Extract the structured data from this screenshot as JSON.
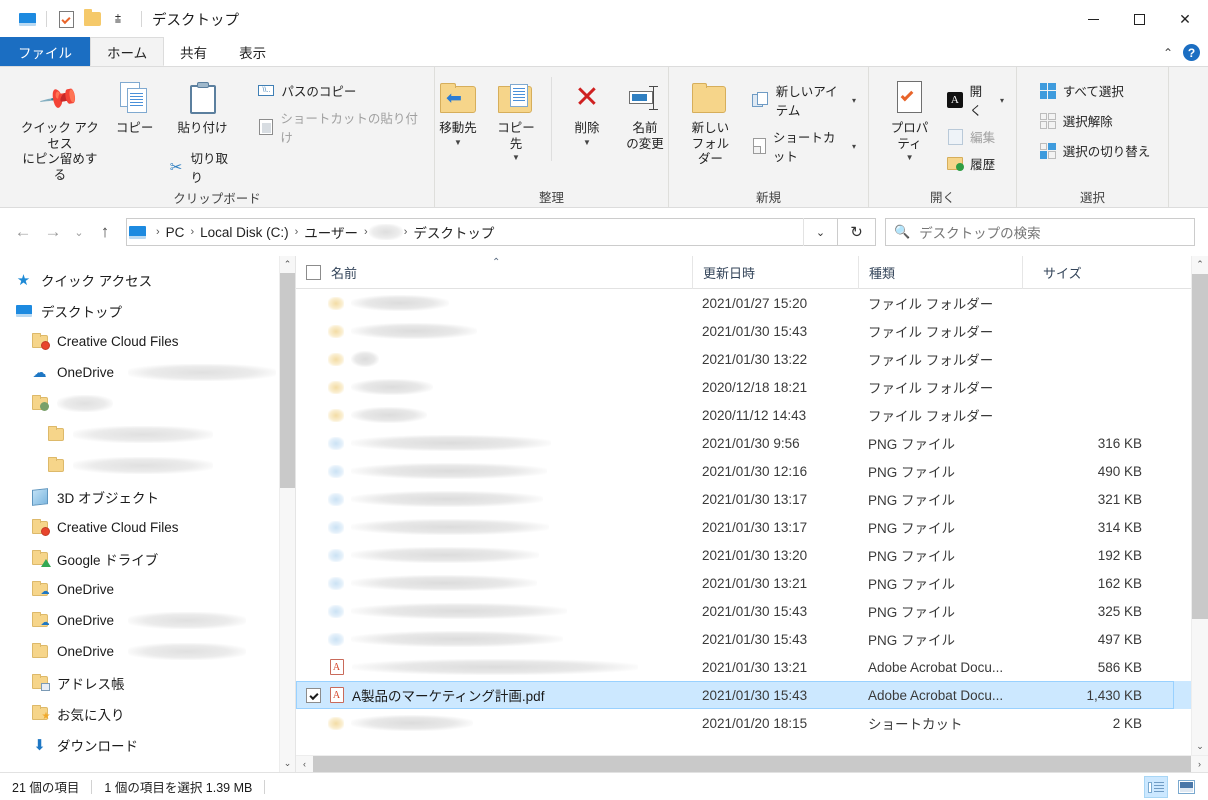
{
  "window": {
    "title": "デスクトップ",
    "quick_access_icons": [
      "pc-icon",
      "properties-checkmark-icon",
      "new-folder-icon",
      "quick-access-dropdown-icon"
    ],
    "minimize_label": "",
    "maximize_label": "",
    "close_label": "✕"
  },
  "ribbon": {
    "tabs": [
      {
        "label": "ファイル",
        "kind": "file"
      },
      {
        "label": "ホーム",
        "kind": "active"
      },
      {
        "label": "共有",
        "kind": "normal"
      },
      {
        "label": "表示",
        "kind": "normal"
      }
    ],
    "collapse_icon": "⌃",
    "help_icon": "?",
    "groups": [
      {
        "name": "clipboard",
        "label": "クリップボード",
        "pin_label_line1": "クイック アクセス",
        "pin_label_line2": "にピン留めする",
        "copy_label": "コピー",
        "paste_label": "貼り付け",
        "cut_label": "切り取り",
        "copy_path_label": "パスのコピー",
        "paste_shortcut_label": "ショートカットの貼り付け"
      },
      {
        "name": "organize",
        "label": "整理",
        "move_to_label": "移動先",
        "copy_to_label": "コピー先",
        "delete_label": "削除",
        "rename_label_line1": "名前",
        "rename_label_line2": "の変更"
      },
      {
        "name": "new",
        "label": "新規",
        "new_folder_line1": "新しい",
        "new_folder_line2": "フォルダー",
        "new_item_label": "新しいアイテム",
        "shortcut_label": "ショートカット"
      },
      {
        "name": "open",
        "label": "開く",
        "properties_label": "プロパティ",
        "open_label": "開く",
        "edit_label": "編集",
        "history_label": "履歴"
      },
      {
        "name": "select",
        "label": "選択",
        "select_all_label": "すべて選択",
        "select_none_label": "選択解除",
        "invert_selection_label": "選択の切り替え"
      }
    ]
  },
  "address_bar": {
    "back_icon": "←",
    "forward_icon": "→",
    "recent_icon": "⌄",
    "up_icon": "↑",
    "breadcrumbs": [
      "PC",
      "Local Disk (C:)",
      "ユーザー",
      "",
      "デスクトップ"
    ],
    "breadcrumb_redacted_index": 3,
    "separator": "›",
    "dropdown_icon": "⌄",
    "refresh_icon": "↻"
  },
  "search": {
    "icon": "search-icon",
    "placeholder": "デスクトップの検索",
    "value": ""
  },
  "sidebar": {
    "items": [
      {
        "label": "クイック アクセス",
        "icon": "star-icon",
        "indent": 0,
        "redacted_width": 0
      },
      {
        "label": "デスクトップ",
        "icon": "desktop-icon",
        "indent": 0,
        "redacted_width": 0
      },
      {
        "label": "Creative Cloud Files",
        "icon": "creative-cloud-folder-icon",
        "indent": 1,
        "redacted_width": 0
      },
      {
        "label": "OneDrive",
        "icon": "onedrive-cloud-icon",
        "indent": 1,
        "redacted_width": 148
      },
      {
        "label": "",
        "icon": "user-folder-icon",
        "indent": 1,
        "redacted_width": 56
      },
      {
        "label": "",
        "icon": "folder-icon",
        "indent": 2,
        "redacted_width": 140
      },
      {
        "label": "",
        "icon": "folder-icon",
        "indent": 2,
        "redacted_width": 140
      },
      {
        "label": "3D オブジェクト",
        "icon": "3d-objects-icon",
        "indent": 1,
        "redacted_width": 0
      },
      {
        "label": "Creative Cloud Files",
        "icon": "creative-cloud-folder-icon",
        "indent": 1,
        "redacted_width": 0
      },
      {
        "label": "Google ドライブ",
        "icon": "google-drive-folder-icon",
        "indent": 1,
        "redacted_width": 0
      },
      {
        "label": "OneDrive",
        "icon": "onedrive-folder-icon",
        "indent": 1,
        "redacted_width": 0
      },
      {
        "label": "OneDrive",
        "icon": "onedrive-folder-icon",
        "indent": 1,
        "redacted_width": 118
      },
      {
        "label": "OneDrive",
        "icon": "folder-icon",
        "indent": 1,
        "redacted_width": 118
      },
      {
        "label": "アドレス帳",
        "icon": "address-book-folder-icon",
        "indent": 1,
        "redacted_width": 0
      },
      {
        "label": "お気に入り",
        "icon": "favorites-folder-icon",
        "indent": 1,
        "redacted_width": 0
      },
      {
        "label": "ダウンロード",
        "icon": "downloads-icon",
        "indent": 1,
        "redacted_width": 0
      }
    ]
  },
  "file_list": {
    "columns": [
      {
        "key": "name",
        "label": "名前",
        "sorted": true,
        "sort_direction": "asc"
      },
      {
        "key": "date",
        "label": "更新日時"
      },
      {
        "key": "type",
        "label": "種類"
      },
      {
        "key": "size",
        "label": "サイズ"
      }
    ],
    "rows": [
      {
        "name": "",
        "redacted_width": 98,
        "icon": "folder-icon",
        "date": "2021/01/27 15:20",
        "type": "ファイル フォルダー",
        "size": "",
        "selected": false
      },
      {
        "name": "",
        "redacted_width": 126,
        "icon": "folder-icon",
        "date": "2021/01/30 15:43",
        "type": "ファイル フォルダー",
        "size": "",
        "selected": false
      },
      {
        "name": "",
        "redacted_width": 28,
        "icon": "folder-icon",
        "date": "2021/01/30 13:22",
        "type": "ファイル フォルダー",
        "size": "",
        "selected": false
      },
      {
        "name": "",
        "redacted_width": 82,
        "icon": "folder-icon",
        "date": "2020/12/18 18:21",
        "type": "ファイル フォルダー",
        "size": "",
        "selected": false
      },
      {
        "name": "",
        "redacted_width": 76,
        "icon": "folder-icon",
        "date": "2020/11/12 14:43",
        "type": "ファイル フォルダー",
        "size": "",
        "selected": false
      },
      {
        "name": "",
        "redacted_width": 200,
        "icon": "png-icon",
        "date": "2021/01/30 9:56",
        "type": "PNG ファイル",
        "size": "316 KB",
        "selected": false
      },
      {
        "name": "",
        "redacted_width": 196,
        "icon": "png-icon",
        "date": "2021/01/30 12:16",
        "type": "PNG ファイル",
        "size": "490 KB",
        "selected": false
      },
      {
        "name": "",
        "redacted_width": 192,
        "icon": "png-icon",
        "date": "2021/01/30 13:17",
        "type": "PNG ファイル",
        "size": "321 KB",
        "selected": false
      },
      {
        "name": "",
        "redacted_width": 198,
        "icon": "png-icon",
        "date": "2021/01/30 13:17",
        "type": "PNG ファイル",
        "size": "314 KB",
        "selected": false
      },
      {
        "name": "",
        "redacted_width": 188,
        "icon": "png-icon",
        "date": "2021/01/30 13:20",
        "type": "PNG ファイル",
        "size": "192 KB",
        "selected": false
      },
      {
        "name": "",
        "redacted_width": 186,
        "icon": "png-icon",
        "date": "2021/01/30 13:21",
        "type": "PNG ファイル",
        "size": "162 KB",
        "selected": false
      },
      {
        "name": "",
        "redacted_width": 216,
        "icon": "png-icon",
        "date": "2021/01/30 15:43",
        "type": "PNG ファイル",
        "size": "325 KB",
        "selected": false
      },
      {
        "name": "",
        "redacted_width": 212,
        "icon": "png-icon",
        "date": "2021/01/30 15:43",
        "type": "PNG ファイル",
        "size": "497 KB",
        "selected": false
      },
      {
        "name": "",
        "redacted_width": 286,
        "icon": "pdf-icon",
        "date": "2021/01/30 13:21",
        "type": "Adobe Acrobat Docu...",
        "size": "586 KB",
        "selected": false
      },
      {
        "name": "A製品のマーケティング計画.pdf",
        "redacted_width": 0,
        "icon": "pdf-icon",
        "date": "2021/01/30 15:43",
        "type": "Adobe Acrobat Docu...",
        "size": "1,430 KB",
        "selected": true
      },
      {
        "name": "",
        "redacted_width": 122,
        "icon": "shortcut-icon",
        "date": "2021/01/20 18:15",
        "type": "ショートカット",
        "size": "2 KB",
        "selected": false
      }
    ]
  },
  "status_bar": {
    "item_count": "21 個の項目",
    "selection_info": "1 個の項目を選択  1.39 MB",
    "view_details_icon": "details-view-icon",
    "view_large_icon": "large-icons-view-icon"
  }
}
